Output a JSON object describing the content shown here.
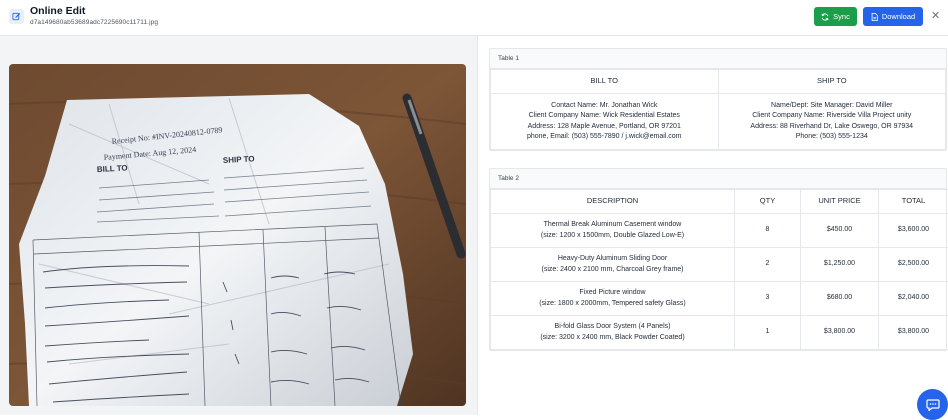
{
  "header": {
    "title": "Online Edit",
    "filename": "d7a149680ab53689adc7225690c11711.jpg",
    "sync_label": "Sync",
    "download_label": "Download"
  },
  "colors": {
    "sync": "#1a9e4a",
    "download": "#2563eb",
    "chat": "#2563eb"
  },
  "photo": {
    "receipt_no": "Receipt No: #INV-20240812-0789",
    "payment_date": "Payment Date: Aug 12, 2024",
    "bill_to": "BILL TO",
    "ship_to": "SHIP TO"
  },
  "table1": {
    "title": "Table 1",
    "headers": [
      "BILL TO",
      "SHIP TO"
    ],
    "bill_lines": [
      "Contact Name: Mr. Jonathan Wick",
      "Client Company Name: Wick Residential Estates",
      "Address: 128 Maple Avenue, Portland, OR 97201",
      "phone, Email: (503) 555-7890 / j.wick@email.com"
    ],
    "ship_lines": [
      "Name/Dept: Site Manager: David Miller",
      "Client Company Name: Riverside Villa Project unity",
      "Address: 88 Riverhand Dr, Lake Oswego, OR 97934",
      "Phone: (503) 555-1234"
    ]
  },
  "table2": {
    "title": "Table 2",
    "headers": [
      "DESCRIPTION",
      "QTY",
      "UNIT PRICE",
      "TOTAL"
    ],
    "rows": [
      {
        "desc1": "Thermal Break Aluminum Casement window",
        "desc2": "(size: 1200 x 1500mm, Double Glazed Low-E)",
        "qty": "8",
        "unit": "$450.00",
        "total": "$3,600.00"
      },
      {
        "desc1": "Heavy-Duty Aluminum Sliding Door",
        "desc2": "(size: 2400 x 2100 mm, Charcoal Grey frame)",
        "qty": "2",
        "unit": "$1,250.00",
        "total": "$2,500.00"
      },
      {
        "desc1": "Fixed Picture window",
        "desc2": "(size: 1800 x 2000mm, Tempered safety Glass)",
        "qty": "3",
        "unit": "$680.00",
        "total": "$2,040.00"
      },
      {
        "desc1": "Bi-fold Glass Door System (4 Panels)",
        "desc2": "(size: 3200 x 2400 mm, Black Powder Coated)",
        "qty": "1",
        "unit": "$3,800.00",
        "total": "$3,800.00"
      }
    ]
  }
}
